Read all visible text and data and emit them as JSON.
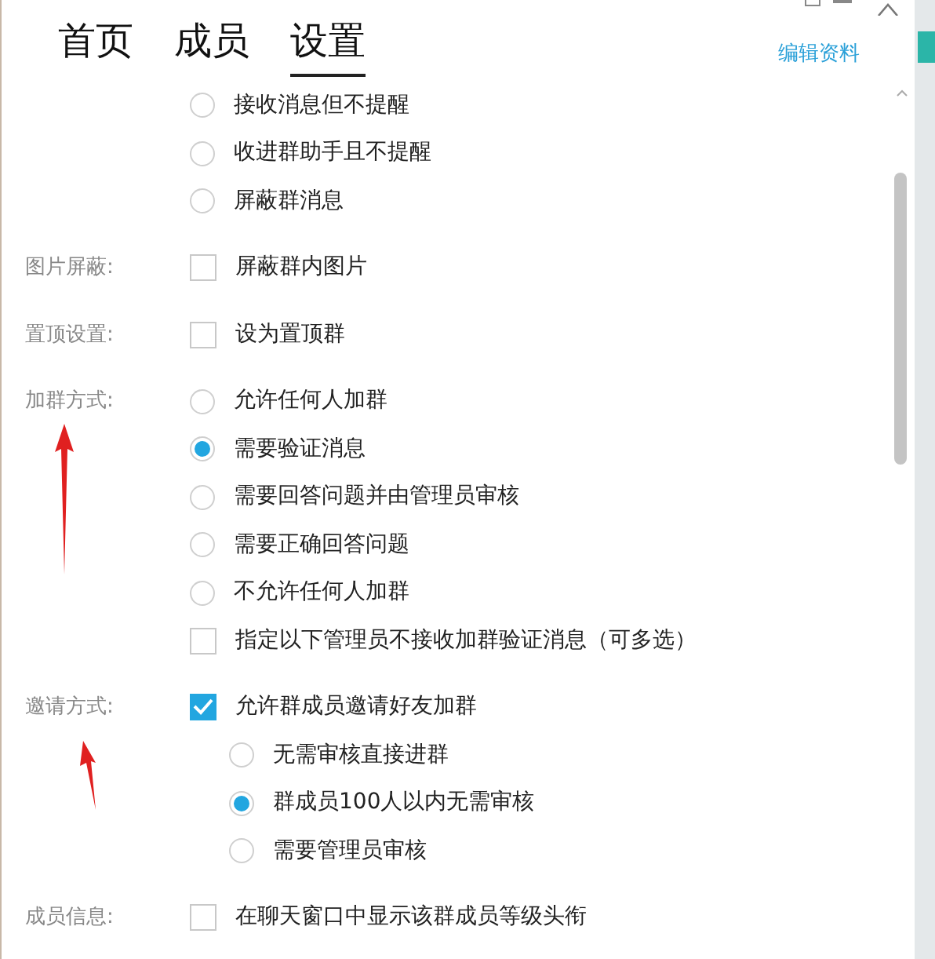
{
  "tabs": [
    {
      "label": "首页",
      "selected": false
    },
    {
      "label": "成员",
      "selected": false
    },
    {
      "label": "设置",
      "selected": true
    }
  ],
  "edit_link": "编辑资料",
  "sections": [
    {
      "options": [
        {
          "kind": "radio",
          "text": "接收消息但不提醒",
          "selected": false
        },
        {
          "kind": "radio",
          "text": "收进群助手且不提醒",
          "selected": false
        },
        {
          "kind": "radio",
          "text": "屏蔽群消息",
          "selected": false
        }
      ]
    },
    {
      "label": "图片屏蔽:",
      "options": [
        {
          "kind": "checkbox",
          "text": "屏蔽群内图片",
          "checked": false
        }
      ]
    },
    {
      "label": "置顶设置:",
      "options": [
        {
          "kind": "checkbox",
          "text": "设为置顶群",
          "checked": false
        }
      ]
    },
    {
      "label": "加群方式:",
      "options": [
        {
          "kind": "radio",
          "text": "允许任何人加群",
          "selected": false
        },
        {
          "kind": "radio",
          "text": "需要验证消息",
          "selected": true
        },
        {
          "kind": "radio",
          "text": "需要回答问题并由管理员审核",
          "selected": false
        },
        {
          "kind": "radio",
          "text": "需要正确回答问题",
          "selected": false
        },
        {
          "kind": "radio",
          "text": "不允许任何人加群",
          "selected": false
        },
        {
          "kind": "checkbox",
          "text": "指定以下管理员不接收加群验证消息（可多选）",
          "checked": false
        }
      ]
    },
    {
      "label": "邀请方式:",
      "options": [
        {
          "kind": "checkbox",
          "text": "允许群成员邀请好友加群",
          "checked": true,
          "children": [
            {
              "kind": "radio",
              "text": "无需审核直接进群",
              "selected": false
            },
            {
              "kind": "radio",
              "text": "群成员100人以内无需审核",
              "selected": true
            },
            {
              "kind": "radio",
              "text": "需要管理员审核",
              "selected": false
            }
          ]
        }
      ]
    },
    {
      "label": "成员信息:",
      "options": [
        {
          "kind": "checkbox",
          "text": "在聊天窗口中显示该群成员等级头衔",
          "checked": false
        }
      ]
    }
  ]
}
